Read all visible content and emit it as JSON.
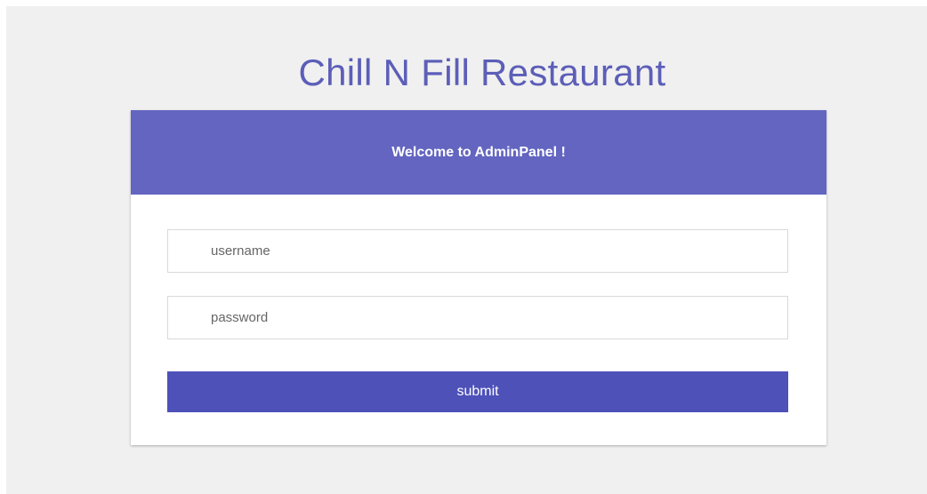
{
  "site": {
    "title": "Chill N Fill Restaurant"
  },
  "login": {
    "header": "Welcome to AdminPanel !",
    "username_placeholder": "username",
    "password_placeholder": "password",
    "submit_label": "submit"
  },
  "colors": {
    "title": "#5c5eb8",
    "header_bg": "#6365c1",
    "button_bg": "#4d51b8",
    "page_bg": "#f0f0f0"
  }
}
